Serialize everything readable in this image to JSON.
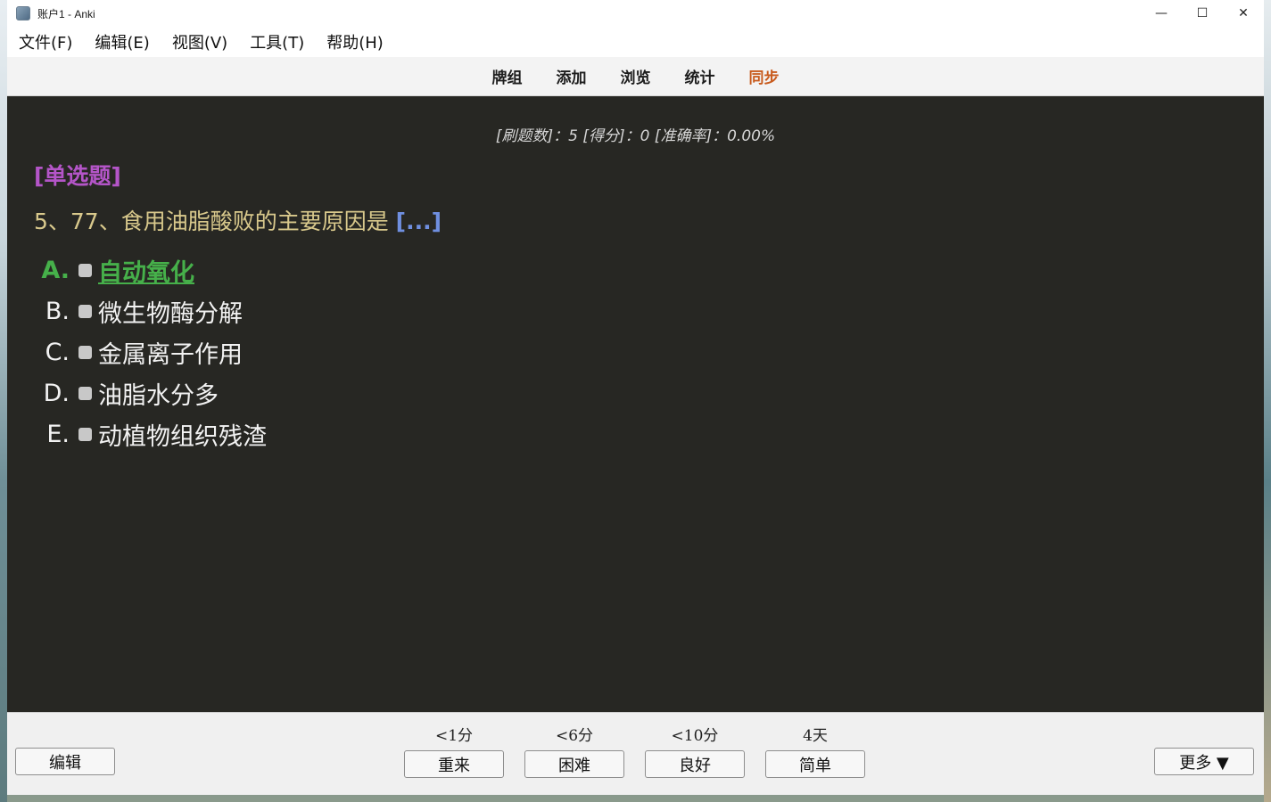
{
  "window": {
    "title": "账户1 - Anki",
    "controls": {
      "minimize": "—",
      "maximize": "☐",
      "close": "✕"
    }
  },
  "menubar": {
    "items": [
      "文件(F)",
      "编辑(E)",
      "视图(V)",
      "工具(T)",
      "帮助(H)"
    ]
  },
  "toolbar": {
    "items": [
      "牌组",
      "添加",
      "浏览",
      "统计",
      "同步"
    ],
    "sync_color": "#c85a1c"
  },
  "card": {
    "stats": "[刷题数]：5 [得分]：0 [准确率]：0.00%",
    "question_type": "[单选题]",
    "question": "5、77、食用油脂酸败的主要原因是",
    "cloze": "[...]",
    "options": [
      {
        "letter": "A.",
        "text": "自动氧化",
        "correct": true
      },
      {
        "letter": "B.",
        "text": "微生物酶分解",
        "correct": false
      },
      {
        "letter": "C.",
        "text": "金属离子作用",
        "correct": false
      },
      {
        "letter": "D.",
        "text": "油脂水分多",
        "correct": false
      },
      {
        "letter": "E.",
        "text": "动植物组织残渣",
        "correct": false
      }
    ]
  },
  "bottom": {
    "edit_label": "编辑",
    "more_label": "更多 ▼",
    "ease_buttons": [
      {
        "time": "<1分",
        "label": "重来"
      },
      {
        "time": "<6分",
        "label": "困难"
      },
      {
        "time": "<10分",
        "label": "良好"
      },
      {
        "time": "4天",
        "label": "简单"
      }
    ]
  },
  "colors": {
    "reviewer_background": "#272723",
    "question_type": "#b455c8",
    "question_text": "#d9c98c",
    "cloze": "#6f8fe0",
    "correct_option": "#46b04a"
  }
}
